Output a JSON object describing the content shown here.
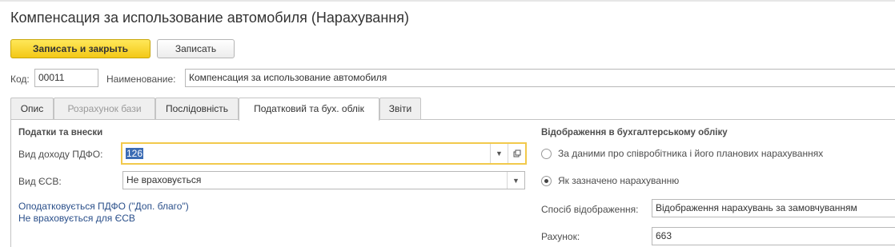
{
  "window": {
    "title": "Компенсация за использование автомобиля (Нарахування)"
  },
  "toolbar": {
    "save_close_label": "Записать и закрыть",
    "save_label": "Записать"
  },
  "header": {
    "code_label": "Код:",
    "code_value": "00011",
    "name_label": "Наименование:",
    "name_value": "Компенсация за использование автомобиля"
  },
  "tabs": [
    {
      "label": "Опис",
      "state": "normal"
    },
    {
      "label": "Розрахунок бази",
      "state": "disabled"
    },
    {
      "label": "Послідовність",
      "state": "normal"
    },
    {
      "label": "Податковий та бух. облік",
      "state": "active"
    },
    {
      "label": "Звіти",
      "state": "normal"
    }
  ],
  "taxes": {
    "section_title": "Податки та внески",
    "pdfo_label": "Вид доходу ПДФО:",
    "pdfo_value": "126",
    "esv_label": "Вид ЄСВ:",
    "esv_value": "Не враховується",
    "note_pdfo": "Оподатковується ПДФО (\"Доп. благо\")",
    "note_esv": "Не враховується для ЄСВ"
  },
  "accounting": {
    "section_title": "Відображення в бухгалтерському обліку",
    "options": [
      {
        "label": "За даними про співробітника і його планових нарахуваннях",
        "checked": false
      },
      {
        "label": "Як зазначено нарахуванню",
        "checked": true
      }
    ],
    "method_label": "Спосіб відображення:",
    "method_value": "Відображення нарахувань за замовчуванням",
    "account_label": "Рахунок:",
    "account_value": "663"
  },
  "icons": {
    "dropdown": "chevron-down-icon",
    "open": "open-form-icon"
  },
  "colors": {
    "primary_button": "#f5d21f",
    "focus_border": "#f2c94c",
    "link": "#2a4f8a",
    "selection": "#3c6cb4"
  }
}
